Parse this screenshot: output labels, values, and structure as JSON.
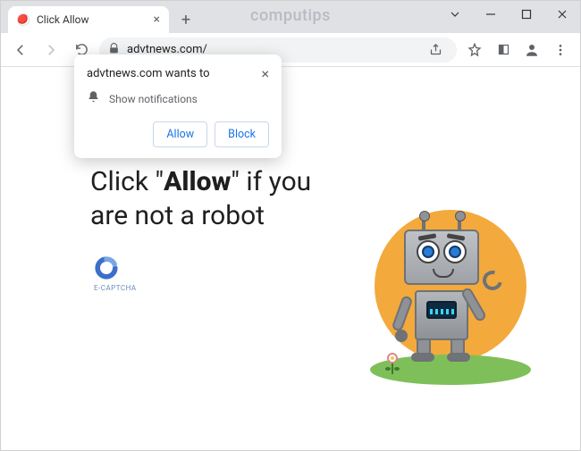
{
  "window": {
    "watermark": "computips",
    "tab_title": "Click Allow"
  },
  "toolbar": {
    "url": "advtnews.com/"
  },
  "permission_popup": {
    "title": "advtnews.com wants to",
    "message": "Show notifications",
    "allow_label": "Allow",
    "block_label": "Block"
  },
  "page": {
    "headline_pre": "Click \"",
    "headline_bold": "Allow",
    "headline_post": "\" if you are not a robot",
    "captcha_label": "E-CAPTCHA"
  }
}
